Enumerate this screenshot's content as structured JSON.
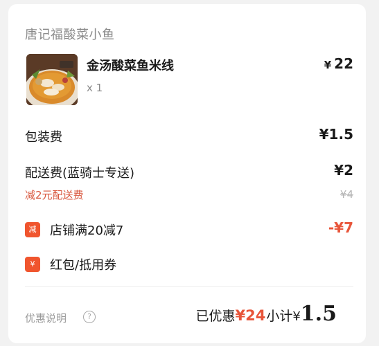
{
  "shop": {
    "name": "唐记福酸菜小鱼"
  },
  "item": {
    "name": "金汤酸菜鱼米线",
    "qty": "x 1",
    "currency": "¥",
    "price": "22",
    "image_icon": "food-photo-icon"
  },
  "packaging": {
    "label": "包装费",
    "value": "¥1.5"
  },
  "delivery": {
    "label": "配送费(蓝骑士专送)",
    "value": "¥2",
    "discount_label": "减2元配送费",
    "original_value": "¥4"
  },
  "promos": [
    {
      "badge": "减",
      "label": "店铺满20减7",
      "value": "-¥7",
      "badge_color": "#f0552e"
    },
    {
      "badge": "¥",
      "label": "红包/抵用券",
      "badge_color": "#f0552e"
    }
  ],
  "footer": {
    "discount_note": "优惠说明",
    "help_icon": "?",
    "saved_label": "已优惠",
    "saved_amount": "¥24",
    "subtotal_label": "小计",
    "total_currency": "¥",
    "total_amount": "1.5"
  },
  "colors": {
    "accent": "#e8553a",
    "badge": "#f0552e",
    "muted": "#8a8a8a"
  }
}
